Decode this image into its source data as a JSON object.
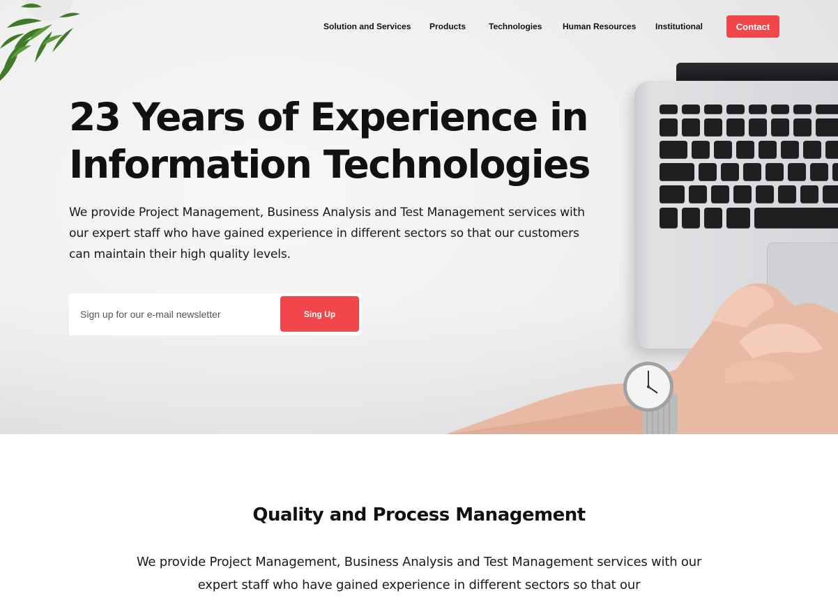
{
  "nav": {
    "items": [
      {
        "label": "Solution and Services"
      },
      {
        "label": "Products"
      },
      {
        "label": "Technologies"
      },
      {
        "label": "Human Resources"
      },
      {
        "label": "Institutional"
      }
    ],
    "contact_label": "Contact"
  },
  "hero": {
    "title": "23 Years of Experience in Information Technologies",
    "description": "We provide Project Management, Business Analysis and Test Management services with our expert staff who have gained experience in different sectors so that our customers can maintain their high quality levels.",
    "newsletter": {
      "placeholder": "Sign up for our e-mail newsletter",
      "button_label": "Sing Up"
    }
  },
  "section": {
    "title": "Quality and Process Management",
    "description": "We provide Project Management, Business Analysis and Test Management services with our expert staff who have gained experience in different sectors so that our"
  },
  "colors": {
    "accent": "#f2474a",
    "text": "#111111",
    "background": "#ffffff"
  },
  "icons": {
    "plant": "plant-decoration",
    "laptop": "laptop-image",
    "hands": "hands-with-watch-image"
  }
}
